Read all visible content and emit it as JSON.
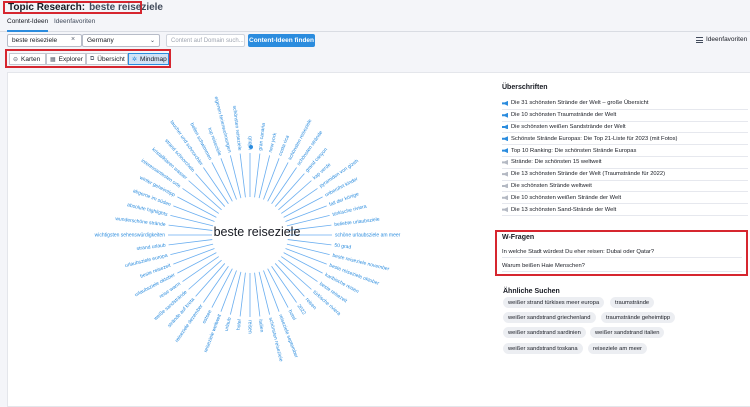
{
  "header": {
    "title": "Topic Research:",
    "keyword": "beste reiseziele"
  },
  "tabs": [
    {
      "label": "Content-Ideen",
      "active": true
    },
    {
      "label": "Ideenfavoriten",
      "active": false
    }
  ],
  "controls": {
    "search_value": "beste reiseziele",
    "clear_icon": "×",
    "country": "Germany",
    "chevron": "⌄",
    "domain_placeholder": "Content auf Domain such...",
    "find_button": "Content-Ideen finden",
    "favorites_link": "Ideenfavoriten"
  },
  "views": [
    {
      "label": "Karten",
      "icon": "⊖",
      "active": false
    },
    {
      "label": "Explorer",
      "icon": "▦",
      "active": false
    },
    {
      "label": "Übersicht",
      "icon": "⧉",
      "active": false
    },
    {
      "label": "Mindmap",
      "icon": "✲",
      "active": true
    }
  ],
  "mindmap": {
    "center": "beste reiseziele",
    "center_color": "#171a22",
    "line_color": "#6aaef0",
    "label_color": "#2b8cde",
    "labels": [
      "urlaub",
      "gran canaria",
      "new york",
      "costa rica",
      "schönsten reiseziele",
      "schönsten strände",
      "grand canyon",
      "kap verde",
      "pyramiden von gizeh",
      "unberührt kinder",
      "fall der könige",
      "türkische riviera",
      "beliebte urlaubsziele",
      "schöne urlaubsziele am meer",
      "50 grad",
      "beste reiseziele november",
      "beste reiseziele oktober",
      "karibische reisen",
      "beste reisezeit",
      "türkische riviera",
      "reisen",
      "2022",
      "hotel",
      "reiseziele september",
      "schönsten reiseziele",
      "italien",
      "reisen",
      "hotel",
      "urlaub",
      "reiseziele weltweit",
      "ostsee",
      "reiseziele dezember",
      "strände auf kreta",
      "weiße sandstrände",
      "reise warm",
      "urlaubsziele oktober",
      "beste reisezeit",
      "urlaubsziele europa",
      "strand urlaub",
      "wichtigsten sehenswürdigkeiten",
      "wunderschöne strände",
      "absolute highlights",
      "abgerne im süden",
      "winter geheimtipp",
      "interessantesten orte",
      "kristallklaren wasser",
      "strand schnorcheln",
      "taucher und schnorchler",
      "bellen schwimmen",
      "top reiseziele",
      "eigenen ferienwohnungen",
      "schönsten reiseziele"
    ]
  },
  "headings": {
    "title": "Überschriften",
    "items": [
      {
        "text": "Die 31 schönsten Strände der Welt – große Übersicht",
        "icon": "megaphone-blue"
      },
      {
        "text": "Die 10 schönsten Traumstrände der Welt",
        "icon": "megaphone-blue"
      },
      {
        "text": "Die schönsten weißen Sandstrände der Welt",
        "icon": "megaphone-blue"
      },
      {
        "text": "Schönste Strände Europas: Die Top 21-Liste für 2023 (mit Fotos)",
        "icon": "megaphone-blue"
      },
      {
        "text": "Top 10 Ranking: Die schönsten Strände Europas",
        "icon": "megaphone-blue"
      },
      {
        "text": "Strände: Die schönsten 15 weltweit",
        "icon": "megaphone-grey"
      },
      {
        "text": "Die 13 schönsten Strände der Welt (Traumstrände für 2022)",
        "icon": "megaphone-grey"
      },
      {
        "text": "Die schönsten Strände weltweit",
        "icon": "megaphone-grey"
      },
      {
        "text": "Die 10 schönsten weißen Strände der Welt",
        "icon": "megaphone-grey"
      },
      {
        "text": "Die 13 schönsten Sand-Strände der Welt",
        "icon": "megaphone-grey"
      }
    ]
  },
  "w_questions": {
    "title": "W-Fragen",
    "items": [
      "In welche Stadt würdest Du eher reisen: Dubai oder Qatar?",
      "Warum beißen Haie Menschen?"
    ]
  },
  "similar": {
    "title": "Ähnliche Suchen",
    "chips": [
      "weißer strand türkises meer europa",
      "traumstrände",
      "weißer sandstrand griechenland",
      "traumstrände geheimtipp",
      "weißer sandstrand sardinien",
      "weißer sandstrand italien",
      "weißer sandstrand toskana",
      "reiseziele am meer"
    ]
  }
}
